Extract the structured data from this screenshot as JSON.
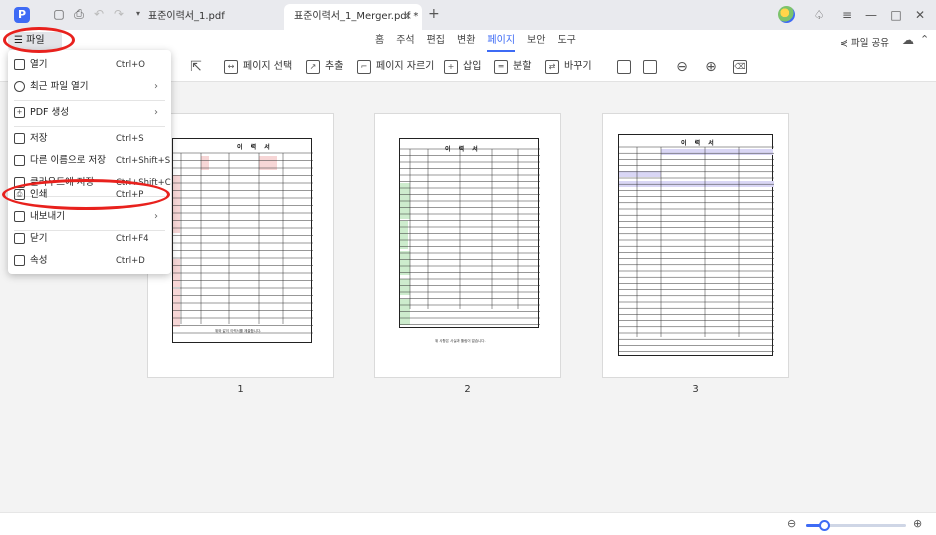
{
  "titlebar": {
    "logo_glyph": "P",
    "tabs": [
      {
        "label": "표준이력서_1.pdf",
        "active": false
      },
      {
        "label": "표준이력서_1_Merger.pdf *",
        "active": true
      }
    ],
    "close_glyph": "×",
    "new_tab_glyph": "+"
  },
  "menubar": {
    "file_label": "☰ 파일",
    "tabs": [
      "홈",
      "주석",
      "편집",
      "변환",
      "페이지",
      "보안",
      "도구"
    ],
    "active_tab": "페이지",
    "share_label": "파일 공유"
  },
  "toolbar": {
    "items": [
      {
        "label": "페이지 선택",
        "icon": "page-select-icon"
      },
      {
        "label": "추출",
        "icon": "extract-icon"
      },
      {
        "label": "페이지 자르기",
        "icon": "crop-icon"
      },
      {
        "label": "삽입",
        "icon": "insert-icon"
      },
      {
        "label": "분할",
        "icon": "split-icon"
      },
      {
        "label": "바꾸기",
        "icon": "replace-icon"
      }
    ]
  },
  "file_menu": {
    "items": [
      {
        "label": "열기",
        "shortcut": "Ctrl+O",
        "icon": "open-icon",
        "submenu": false
      },
      {
        "label": "최근 파일 열기",
        "shortcut": "",
        "icon": "recent-icon",
        "submenu": true
      },
      {
        "label": "PDF 생성",
        "shortcut": "",
        "icon": "create-pdf-icon",
        "submenu": true
      },
      {
        "label": "저장",
        "shortcut": "Ctrl+S",
        "icon": "save-icon",
        "submenu": false
      },
      {
        "label": "다른 이름으로 저장",
        "shortcut": "Ctrl+Shift+S",
        "icon": "save-as-icon",
        "submenu": false
      },
      {
        "label": "클라우드에 저장",
        "shortcut": "Ctrl+Shift+C",
        "icon": "cloud-save-icon",
        "submenu": false
      },
      {
        "label": "인쇄",
        "shortcut": "Ctrl+P",
        "icon": "print-icon",
        "submenu": false
      },
      {
        "label": "내보내기",
        "shortcut": "",
        "icon": "export-icon",
        "submenu": true
      },
      {
        "label": "닫기",
        "shortcut": "Ctrl+F4",
        "icon": "close-doc-icon",
        "submenu": false
      },
      {
        "label": "속성",
        "shortcut": "Ctrl+D",
        "icon": "properties-icon",
        "submenu": false
      }
    ],
    "submenu_arrow": "›"
  },
  "pages": [
    {
      "number": "1",
      "doc_title": "이 력 서",
      "footer": "위와 같이 이력서를 제출합니다."
    },
    {
      "number": "2",
      "doc_title": "이 력 서",
      "footer": "위 사항은 사실과 틀림이 없습니다."
    },
    {
      "number": "3",
      "doc_title": "이 력 서",
      "footer": ""
    }
  ],
  "status": {
    "zoom_fraction": 0.18,
    "zoom_out_glyph": "⊖",
    "zoom_in_glyph": "⊕"
  },
  "colors": {
    "accent": "#3e6bf5",
    "annotation": "#e8211d",
    "pink_cells": "#f7d6d6",
    "green_cells": "#cdeccd",
    "lavender_cells": "#d9d6f5"
  }
}
